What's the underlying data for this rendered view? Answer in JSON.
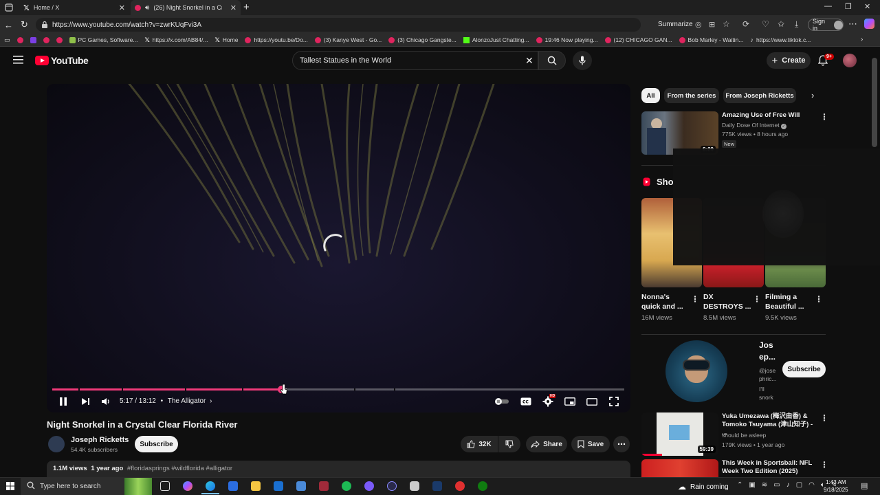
{
  "browser": {
    "tabs": [
      {
        "label": "Home / X",
        "icon": "x-logo-icon"
      },
      {
        "label": "(26) Night Snorkel in a Cryst...",
        "icon": "youtube-icon"
      }
    ],
    "url": "https://www.youtube.com/watch?v=zwrKUqFvi3A",
    "summarize_label": "Summarize",
    "signin_label": "Sign in",
    "bookmarks": [
      "PC Games, Software...",
      "https://x.com/AB84/...",
      "Home",
      "https://youtu.be/Do...",
      "(3) Kanye West - Go...",
      "(3) Chicago Gangste...",
      "AlonzoJust Chatting...",
      "19:46 Now playing...",
      "(12) CHICAGO GAN...",
      "Bob Marley - Waitin...",
      "https://www.tiktok.c..."
    ]
  },
  "youtube": {
    "logo_text": "YouTube",
    "search_value": "Tallest Statues in the World",
    "create_label": "Create",
    "notification_badge": "9+"
  },
  "player": {
    "current_time": "5:17",
    "duration": "13:12",
    "time_display": "5:17 / 13:12",
    "chapter": "The Alligator",
    "progress_fraction": 0.4,
    "buffered_fraction": 0.41
  },
  "video": {
    "title": "Night Snorkel in a Crystal Clear Florida River",
    "channel_name": "Joseph Ricketts",
    "channel_subs": "54.4K subscribers",
    "subscribe_label": "Subscribe",
    "like_count": "32K",
    "share_label": "Share",
    "save_label": "Save",
    "views": "1.1M views",
    "age": "1 year ago",
    "hashtags": "#floridasprings #wildflorida #alligator"
  },
  "sidebar": {
    "chips": [
      "All",
      "From the series",
      "From Joseph Ricketts"
    ],
    "recommendations": [
      {
        "title": "Amazing Use of Free Will",
        "channel": "Daily Dose Of Internet",
        "stats": "775K views • 8 hours ago",
        "badge": "New",
        "duration": "8:29"
      },
      {
        "title": "Yuka Umezawa (梅沢由香) & Tomoko Tsuyama (津山知子) - ...",
        "channel": "should be asleep",
        "stats": "179K views • 1 year ago",
        "duration": "59:39"
      },
      {
        "title": "This Week in Sportsball: NFL Week Two Edition (2025)",
        "channel": "",
        "stats": "",
        "duration": ""
      }
    ],
    "shorts_heading": "Sho",
    "shorts": [
      {
        "title1": "Nonna's",
        "title2": "quick and ...",
        "views": "16M views"
      },
      {
        "title1": "DX",
        "title2": "DESTROYS ...",
        "views": "8.5M views"
      },
      {
        "title1": "Filming a",
        "title2": "Beautiful ...",
        "views": "9.5K views"
      }
    ],
    "channel_card": {
      "name1": "Jos",
      "name2": "ep...",
      "handle1": "@jose",
      "handle2": "phric...",
      "line1": "I'll",
      "line2": "snork",
      "subscribe_label": "Subscribe"
    }
  },
  "taskbar": {
    "search_placeholder": "Type here to search",
    "weather": "Rain coming",
    "time": "1:43 AM",
    "date": "9/18/2025"
  },
  "colors": {
    "yt_red": "#ff0033",
    "progress_pink": "#f03a7a",
    "background": "#0f0f0f"
  }
}
